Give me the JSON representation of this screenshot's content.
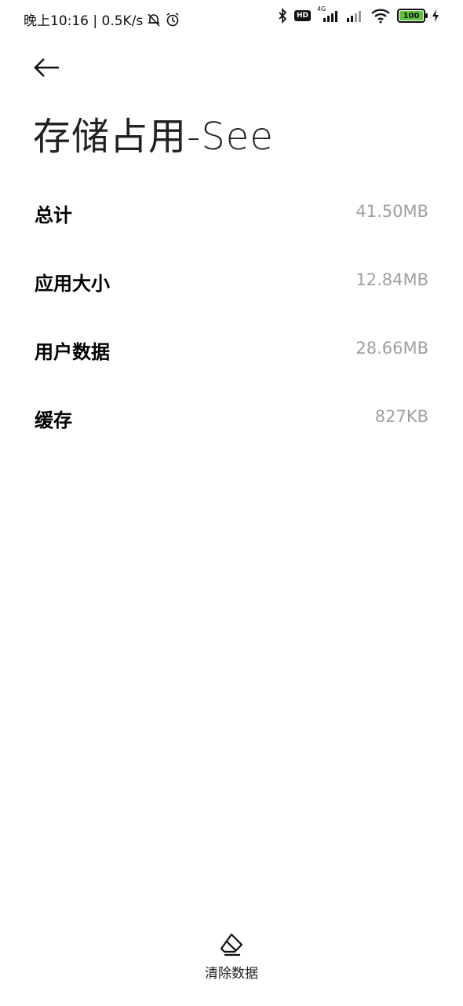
{
  "status_bar": {
    "time_speed": "晚上10:16 | 0.5K/s",
    "network_label": "4G",
    "hd_label": "HD",
    "battery_level": "100",
    "battery_color": "#5ec43b"
  },
  "header": {
    "title": "存储占用-See"
  },
  "storage_items": [
    {
      "label": "总计",
      "value": "41.50MB"
    },
    {
      "label": "应用大小",
      "value": "12.84MB"
    },
    {
      "label": "用户数据",
      "value": "28.66MB"
    },
    {
      "label": "缓存",
      "value": "827KB"
    }
  ],
  "actions": {
    "clear_data_label": "清除数据"
  },
  "colors": {
    "value_text": "#a0a0a0",
    "background": "#ffffff"
  }
}
